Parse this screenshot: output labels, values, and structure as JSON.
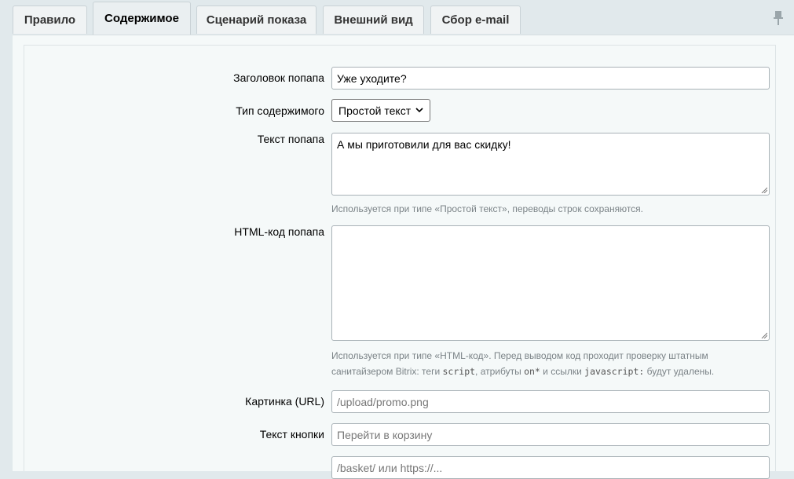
{
  "tabs": [
    {
      "label": "Правило",
      "active": false
    },
    {
      "label": "Содержимое",
      "active": true
    },
    {
      "label": "Сценарий показа",
      "active": false
    },
    {
      "label": "Внешний вид",
      "active": false
    },
    {
      "label": "Сбор e-mail",
      "active": false
    }
  ],
  "form": {
    "popup_title": {
      "label": "Заголовок попапа",
      "value": "Уже уходите?"
    },
    "content_type": {
      "label": "Тип содержимого",
      "value": "Простой текст"
    },
    "popup_text": {
      "label": "Текст попапа",
      "value": "А мы приготовили для вас скидку!",
      "hint": "Используется при типе «Простой текст», переводы строк сохраняются."
    },
    "html_code": {
      "label": "HTML-код попапа",
      "value": "",
      "hint_part1": "Используется при типе «HTML-код». Перед выводом код проходит проверку штатным санитайзером Bitrix: теги ",
      "hint_code1": "script",
      "hint_part2": ", атрибуты ",
      "hint_code2": "on*",
      "hint_part3": " и ссылки ",
      "hint_code3": "javascript:",
      "hint_part4": " будут удалены."
    },
    "image_url": {
      "label": "Картинка (URL)",
      "placeholder": "/upload/promo.png"
    },
    "button_text": {
      "label": "Текст кнопки",
      "placeholder": "Перейти в корзину"
    },
    "button_link": {
      "placeholder": "/basket/ или https://..."
    }
  },
  "icons": {
    "pin": "pin-icon"
  }
}
